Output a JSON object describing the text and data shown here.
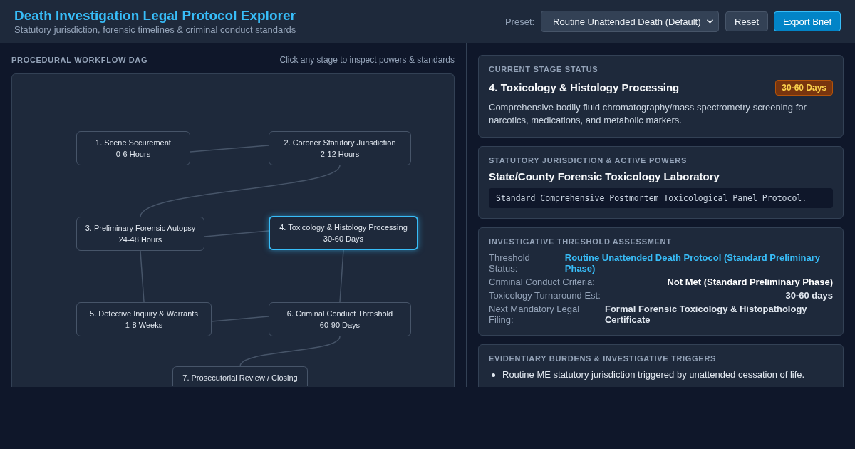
{
  "header": {
    "title": "Death Investigation Legal Protocol Explorer",
    "subtitle": "Statutory jurisdiction, forensic timelines & criminal conduct standards",
    "preset_label": "Preset:",
    "preset": {
      "value": "Routine Unattended Death (Default)"
    },
    "buttons": [
      {
        "label": "Reset",
        "kind": "secondary"
      },
      {
        "label": "Export Brief",
        "kind": "primary"
      }
    ]
  },
  "workflow": {
    "heading": "PROCEDURAL WORKFLOW DAG",
    "hint": "Click any stage to inspect powers & standards",
    "stages": [
      {
        "label": "1. Scene Securement",
        "duration": "0-6 Hours",
        "selected": false
      },
      {
        "label": "2. Coroner Statutory Jurisdiction",
        "duration": "2-12 Hours",
        "selected": false
      },
      {
        "label": "3. Preliminary Forensic Autopsy",
        "duration": "24-48 Hours",
        "selected": false
      },
      {
        "label": "4. Toxicology & Histology Processing",
        "duration": "30-60 Days",
        "selected": true
      },
      {
        "label": "5. Detective Inquiry & Warrants",
        "duration": "1-8 Weeks",
        "selected": false
      },
      {
        "label": "6. Criminal Conduct Threshold",
        "duration": "60-90 Days",
        "selected": false
      },
      {
        "label": "7. Prosecutorial Review / Closing",
        "selected": false
      }
    ]
  },
  "status": {
    "heading": "CURRENT STAGE STATUS",
    "title": "4. Toxicology & Histology Processing",
    "badge": "30-60 Days",
    "description": "Comprehensive bodily fluid chromatography/mass spectrometry screening for narcotics, medications, and metabolic markers."
  },
  "jurisdiction": {
    "heading": "STATUTORY JURISDICTION & ACTIVE POWERS",
    "authority": "State/County Forensic Toxicology Laboratory",
    "protocol": "Standard Comprehensive Postmortem Toxicological Panel Protocol."
  },
  "threshold": {
    "heading": "INVESTIGATIVE THRESHOLD ASSESSMENT",
    "rows": [
      {
        "label": "Threshold Status:",
        "value": "Routine Unattended Death Protocol (Standard Preliminary Phase)",
        "kind": "accent"
      },
      {
        "label": "Criminal Conduct Criteria:",
        "value": "Not Met (Standard Preliminary Phase)",
        "kind": "strong"
      },
      {
        "label": "Toxicology Turnaround Est:",
        "value": "30-60 days",
        "kind": "normal"
      },
      {
        "label": "Next Mandatory Legal Filing:",
        "value": "Formal Forensic Toxicology & Histopathology Certificate",
        "kind": "normal"
      }
    ]
  },
  "triggers": {
    "heading": "EVIDENTIARY BURDENS & INVESTIGATIVE TRIGGERS",
    "items": [
      "Routine ME statutory jurisdiction triggered by unattended cessation of life."
    ]
  }
}
